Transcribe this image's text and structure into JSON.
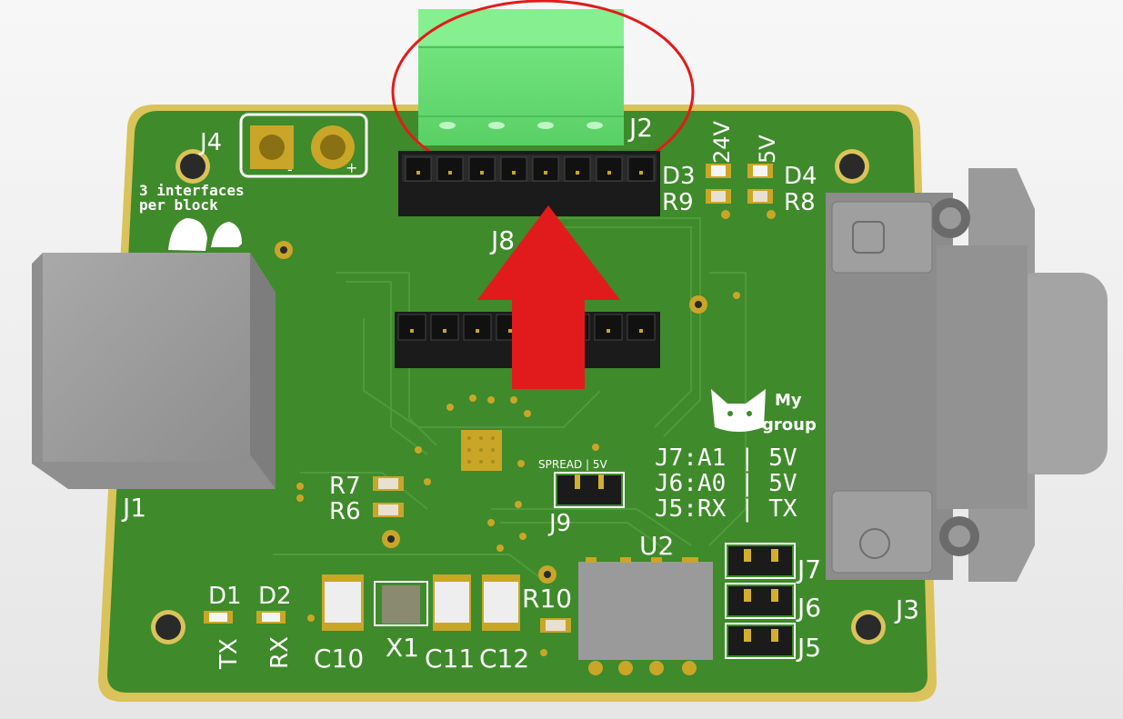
{
  "board": {
    "colors": {
      "pcb": "#3f8a2b",
      "pcb_dark": "#347524",
      "edge": "#d9c35a",
      "silk": "#ffffff",
      "pad": "#c9a628",
      "header": "#1b1b1b",
      "connector_grey": "#9a9a9a",
      "terminal_green": "#6fe07a",
      "highlight_red": "#e11b1b"
    },
    "labels": {
      "j4": "J4",
      "j4_minus": "-",
      "j4_plus": "+",
      "j2": "J2",
      "j8": "J8",
      "j1": "J1",
      "j3": "J3",
      "j5": "J5",
      "j6": "J6",
      "j7": "J7",
      "j9": "J9",
      "u2": "U2",
      "x1": "X1",
      "c10": "C10",
      "c11": "C11",
      "c12": "C12",
      "r6": "R6",
      "r7": "R7",
      "r8": "R8",
      "r9": "R9",
      "r10": "R10",
      "d1": "D1",
      "d2": "D2",
      "d3": "D3",
      "d4": "D4",
      "tx": "TX",
      "rx": "RX",
      "v24": "24V",
      "v5": "5V",
      "note_line1": "3 interfaces",
      "note_line2": "per block",
      "logo_line1": "My",
      "logo_line2": "group",
      "spread": "SPREAD | 5V",
      "j7_map": "J7:A1 | 5V",
      "j6_map": "J6:A0 | 5V",
      "j5_map": "J5:RX | TX"
    },
    "icons": {
      "logo": "cat-face-icon",
      "arrow": "up-arrow-icon",
      "highlight": "ellipse-highlight-icon"
    }
  }
}
